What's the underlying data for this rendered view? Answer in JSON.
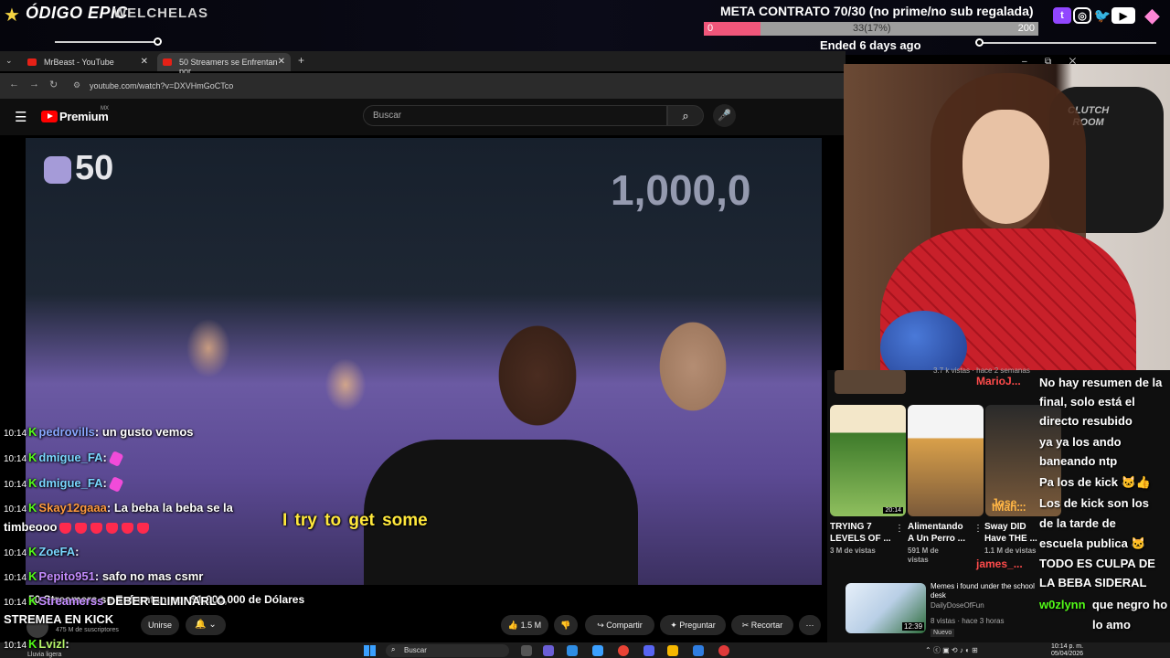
{
  "overlay": {
    "brand_a": "ÓDIGO EPIC",
    "brand_b": "WELCHELAS",
    "meta_title": "META CONTRATO 70/30 (no prime/no sub regalada)",
    "meta_min": "0",
    "meta_center": "33(17%)",
    "meta_max": "200",
    "meta_progress": 0.17,
    "ended": "Ended 6 days ago",
    "social_icons": [
      "twitch-icon",
      "instagram-icon",
      "twitter-icon",
      "youtube-icon"
    ]
  },
  "browser": {
    "tabs": [
      {
        "label": "MrBeast - YouTube"
      },
      {
        "label": "50 Streamers se Enfrentan por"
      }
    ],
    "new_tab": "+",
    "url": "youtube.com/watch?v=DXVHmGoCTco"
  },
  "youtube": {
    "logo_text": "Premium",
    "region": "MX",
    "search_placeholder": "Buscar",
    "video_badge": "50",
    "bg_text": "1,000,0",
    "subtitle": "I try to get some",
    "video_title": "50 Streamers se Enfrentan por $1,000,000 de Dólares",
    "subscribers": "475 M de suscriptores",
    "join_label": "Unirse",
    "likes": "1.5 M",
    "share_label": "Compartir",
    "ask_label": "Preguntar",
    "clip_label": "Recortar",
    "more_label": "⋯"
  },
  "recommended": {
    "top_meta": "3.7 k vistas · hace 2 semanas",
    "videos": [
      {
        "title_1": "TRYING 7",
        "title_2": "LEVELS OF ...",
        "views": "3 M de vistas",
        "duration": "20:14",
        "thumb_color": "#3d7a2a"
      },
      {
        "title_1": "Alimentando",
        "title_2": "A Un Perro ...",
        "views": "591 M de",
        "views_2": "vistas",
        "thumb_color": "#d9a04a"
      },
      {
        "title_1": "Sway DID",
        "title_2": "Have THE ...",
        "views": "1.1 M de vistas",
        "thumb_color": "#7a5a3a"
      }
    ],
    "meme": {
      "title": "Memes i found under the school desk",
      "channel": "DailyDoseOfFun",
      "views": "8 vistas · hace 3 horas",
      "badge": "Nuevo",
      "duration": "12:39"
    }
  },
  "right_chat": [
    "No hay resumen de la",
    "final, solo está el",
    "directo resubido",
    "ya ya los ando",
    "baneando ntp",
    "Pa los de kick 🐱👍",
    "Los de kick son los",
    "de la tarde de",
    "escuela publica 🐱",
    "TODO ES CULPA DE",
    "LA BEBA SIDERAL"
  ],
  "right_chat_users": [
    {
      "user": "MarioJ...",
      "color": "#ff4b4b"
    },
    {
      "user": "IMan...",
      "color": "#ffb545"
    },
    {
      "user": "Jose...",
      "color": "#ffb545"
    },
    {
      "user": "james_...",
      "color": "#ff4b4b"
    }
  ],
  "right_chat_last": {
    "user": "w0zlynn",
    "message_1": "que negro ho",
    "message_2": "lo amo"
  },
  "chat": [
    {
      "time": "10:14",
      "user": "pedrovills",
      "sep": ":",
      "message": "un gusto vemos",
      "color": "user-blue"
    },
    {
      "time": "10:14",
      "user": "dmigue_FA",
      "sep": ":",
      "message": "",
      "color": "user-cyan",
      "emote": "sticker"
    },
    {
      "time": "10:14",
      "user": "dmigue_FA",
      "sep": ":",
      "message": "",
      "color": "user-cyan",
      "emote": "sticker"
    },
    {
      "time": "10:14",
      "user": "Skay12gaaa",
      "sep": ":",
      "message": "La beba la beba se la",
      "color": "user-orange"
    },
    {
      "time": "",
      "user": "",
      "sep": "",
      "message": "timbeooo",
      "color": "",
      "emote": "hearts"
    },
    {
      "time": "10:14",
      "user": "ZoeFA",
      "sep": ":",
      "message": "",
      "color": "user-cyan"
    },
    {
      "time": "10:14",
      "user": "Pepito951",
      "sep": ":",
      "message": "safo no mas csmr",
      "color": "user-purple"
    },
    {
      "time": "10:14",
      "user": "Streamerss",
      "sep": "",
      "message": "DEBER ELIMINARLO",
      "color": "user-purple"
    },
    {
      "time": "",
      "user": "",
      "sep": "",
      "message": "STREMEA EN KICK",
      "color": ""
    },
    {
      "time": "10:14",
      "user": "Lvizl",
      "sep": ":",
      "message": "",
      "color": "user-green"
    }
  ],
  "taskbar": {
    "weather": "Lluvia ligera",
    "search": "Buscar",
    "time": "10:14 p. m.",
    "date": "05/04/2026"
  },
  "chart_colors": {
    "accent": "#f0567a",
    "kick": "#53fc18",
    "youtube": "#ff0000"
  }
}
